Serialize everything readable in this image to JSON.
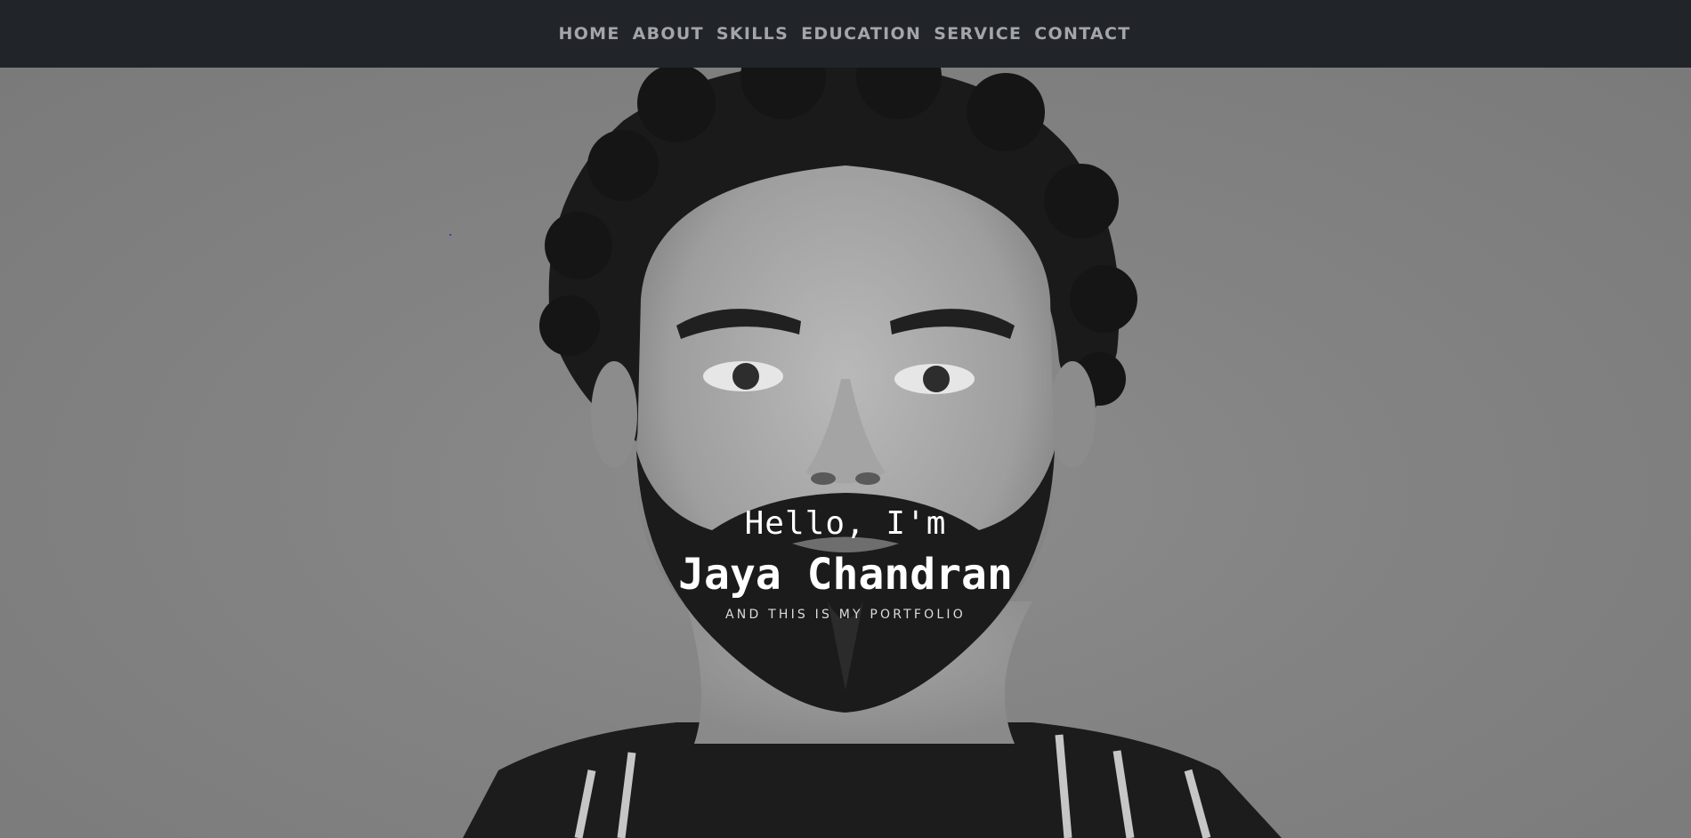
{
  "nav": {
    "items": [
      {
        "label": "HOME"
      },
      {
        "label": "ABOUT"
      },
      {
        "label": "SKILLS"
      },
      {
        "label": "EDUCATION"
      },
      {
        "label": "SERVICE"
      },
      {
        "label": "CONTACT"
      }
    ]
  },
  "hero": {
    "greeting": "Hello, I'm",
    "name": "Jaya Chandran",
    "tagline": "AND THIS IS MY PORTFOLIO"
  },
  "colors": {
    "navbar_bg": "#212429",
    "nav_text": "#a3a5a8",
    "hero_text": "#ffffff",
    "hero_overlay": "#7f7f7f"
  },
  "icons": {
    "hero_image": "portrait-photo"
  }
}
